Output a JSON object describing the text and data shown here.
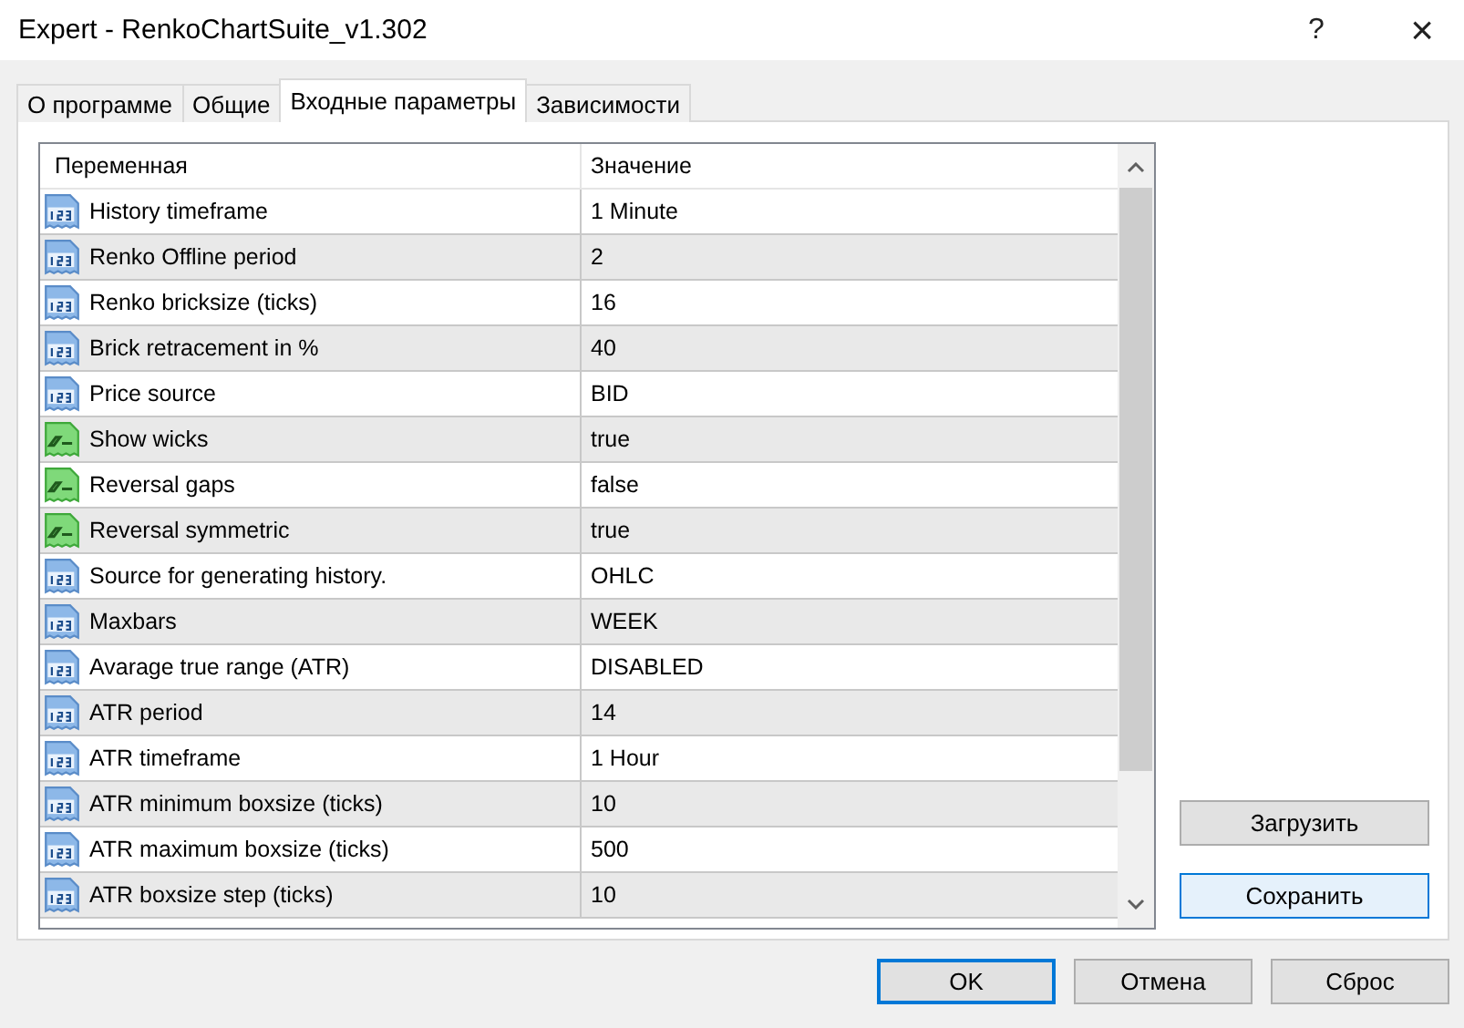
{
  "window": {
    "title": "Expert - RenkoChartSuite_v1.302",
    "help": "?",
    "close": "×"
  },
  "tabs": [
    {
      "label": "О программе",
      "selected": false
    },
    {
      "label": "Общие",
      "selected": false
    },
    {
      "label": "Входные параметры",
      "selected": true
    },
    {
      "label": "Зависимости",
      "selected": false
    }
  ],
  "table": {
    "columns": [
      "Переменная",
      "Значение"
    ],
    "rows": [
      {
        "kind": "number",
        "name": "History timeframe",
        "value": "1 Minute"
      },
      {
        "kind": "number",
        "name": "Renko Offline period",
        "value": "2"
      },
      {
        "kind": "number",
        "name": "Renko bricksize (ticks)",
        "value": "16"
      },
      {
        "kind": "number",
        "name": "Brick retracement in %",
        "value": "40"
      },
      {
        "kind": "number",
        "name": "Price source",
        "value": "BID"
      },
      {
        "kind": "bool",
        "name": "Show wicks",
        "value": "true"
      },
      {
        "kind": "bool",
        "name": "Reversal gaps",
        "value": "false"
      },
      {
        "kind": "bool",
        "name": "Reversal symmetric",
        "value": "true"
      },
      {
        "kind": "number",
        "name": "Source for generating history.",
        "value": "OHLC"
      },
      {
        "kind": "number",
        "name": "Maxbars",
        "value": "WEEK"
      },
      {
        "kind": "number",
        "name": "Avarage true range (ATR)",
        "value": "DISABLED"
      },
      {
        "kind": "number",
        "name": "ATR period",
        "value": "14"
      },
      {
        "kind": "number",
        "name": "ATR timeframe",
        "value": "1 Hour"
      },
      {
        "kind": "number",
        "name": "ATR minimum boxsize (ticks)",
        "value": "10"
      },
      {
        "kind": "number",
        "name": "ATR maximum boxsize (ticks)",
        "value": "500"
      },
      {
        "kind": "number",
        "name": "ATR boxsize step (ticks)",
        "value": "10"
      }
    ]
  },
  "side_buttons": [
    {
      "label": "Загрузить",
      "focused": false
    },
    {
      "label": "Сохранить",
      "focused": true
    }
  ],
  "buttons": [
    {
      "label": "OK",
      "default": true
    },
    {
      "label": "Отмена",
      "default": false
    },
    {
      "label": "Сброс",
      "default": false
    }
  ]
}
